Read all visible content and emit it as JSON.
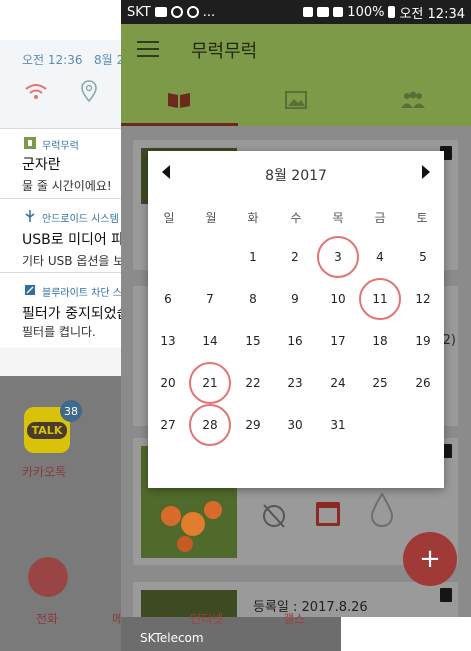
{
  "status_bar": {
    "carrier": "SKT",
    "more": "...",
    "battery": "100%",
    "time": "오전 12:34"
  },
  "app": {
    "title": "무럭무럭",
    "tabs": [
      {
        "icon": "book-icon",
        "active": true
      },
      {
        "icon": "image-icon",
        "active": false
      },
      {
        "icon": "people-icon",
        "active": false
      }
    ],
    "registration_label": "등록일 :  2017.8.26",
    "side_digit": "2)",
    "fab_label": "+"
  },
  "calendar": {
    "month_title": "8월 2017",
    "weekdays": [
      "일",
      "월",
      "화",
      "수",
      "목",
      "금",
      "토"
    ],
    "first_weekday_index": 2,
    "days_in_month": 31,
    "marked_days": [
      3,
      11,
      21,
      28
    ],
    "mark_color": "#e57373"
  },
  "notification_panel": {
    "time": "오전 12:36",
    "date": "8월 2",
    "notifications": [
      {
        "app": "무럭무럭",
        "title": "군자란",
        "body": "물 줄 시간이에요!"
      },
      {
        "app": "안드로이드 시스템",
        "title": "USB로 미디어 파",
        "body": "기타 USB 옵션을 보"
      },
      {
        "app": "블루라이트 차단 스",
        "title": "필터가 중지되었습",
        "body": "필터를 켭니다."
      }
    ]
  },
  "home": {
    "kakao_label": "카카오톡",
    "kakao_badge": "38",
    "kakao_icon_text": "TALK",
    "dock_labels": [
      "전화",
      "메시지",
      "인터넷",
      "갤스"
    ],
    "carrier_text": "SKTelecom"
  }
}
